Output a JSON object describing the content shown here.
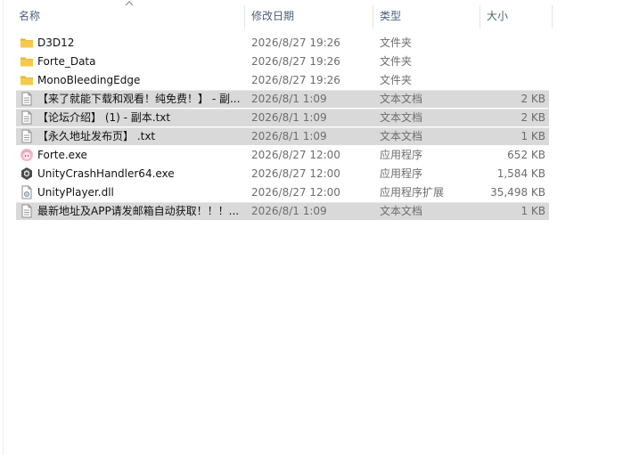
{
  "columns": {
    "name": "名称",
    "date": "修改日期",
    "type": "类型",
    "size": "大小"
  },
  "files": [
    {
      "name": "D3D12",
      "date": "2026/8/27 19:26",
      "type": "文件夹",
      "size": "",
      "icon": "folder-icon",
      "selected": false
    },
    {
      "name": "Forte_Data",
      "date": "2026/8/27 19:26",
      "type": "文件夹",
      "size": "",
      "icon": "folder-icon",
      "selected": false
    },
    {
      "name": "MonoBleedingEdge",
      "date": "2026/8/27 19:26",
      "type": "文件夹",
      "size": "",
      "icon": "folder-icon",
      "selected": false
    },
    {
      "name": "【来了就能下载和观看！纯免费！】 - 副...",
      "date": "2026/8/1 1:09",
      "type": "文本文档",
      "size": "2 KB",
      "icon": "text-file-icon",
      "selected": true
    },
    {
      "name": "【论坛介绍】 (1) - 副本.txt",
      "date": "2026/8/1 1:09",
      "type": "文本文档",
      "size": "2 KB",
      "icon": "text-file-icon",
      "selected": true
    },
    {
      "name": "【永久地址发布页】 .txt",
      "date": "2026/8/1 1:09",
      "type": "文本文档",
      "size": "1 KB",
      "icon": "text-file-icon",
      "selected": true
    },
    {
      "name": "Forte.exe",
      "date": "2026/8/27 12:00",
      "type": "应用程序",
      "size": "652 KB",
      "icon": "app-avatar-icon",
      "selected": false
    },
    {
      "name": "UnityCrashHandler64.exe",
      "date": "2026/8/27 12:00",
      "type": "应用程序",
      "size": "1,584 KB",
      "icon": "unity-icon",
      "selected": false
    },
    {
      "name": "UnityPlayer.dll",
      "date": "2026/8/27 12:00",
      "type": "应用程序扩展",
      "size": "35,498 KB",
      "icon": "dll-file-icon",
      "selected": false
    },
    {
      "name": "最新地址及APP请发邮箱自动获取！！！...",
      "date": "2026/8/1 1:09",
      "type": "文本文档",
      "size": "1 KB",
      "icon": "text-file-icon",
      "selected": true
    }
  ],
  "colors": {
    "selected_row": "#d9d9d9",
    "folder": "#f6c94a",
    "header_text": "#4c607a"
  }
}
